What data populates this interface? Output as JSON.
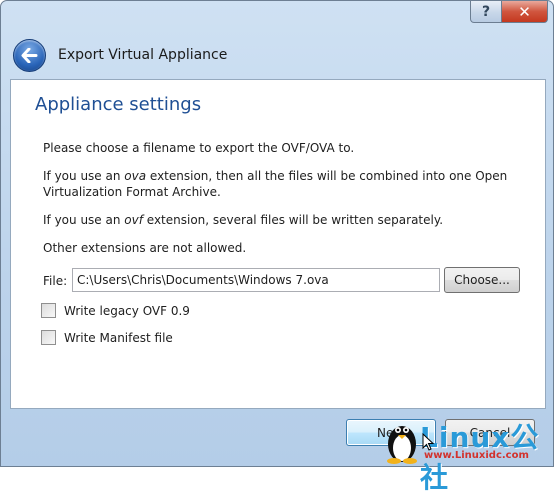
{
  "window": {
    "help_glyph": "?",
    "close_glyph": "✕",
    "wizard_title": "Export Virtual Appliance"
  },
  "page": {
    "heading": "Appliance settings",
    "para1": "Please choose a filename to export the OVF/OVA to.",
    "para2_a": "If you use an ",
    "para2_em": "ova",
    "para2_b": " extension, then all the files will be combined into one Open Virtualization Format Archive.",
    "para3_a": "If you use an ",
    "para3_em": "ovf",
    "para3_b": " extension, several files will be written separately.",
    "para4": "Other extensions are not allowed."
  },
  "file": {
    "label": "File:",
    "value": "C:\\Users\\Chris\\Documents\\Windows 7.ova",
    "choose_label": "Choose..."
  },
  "options": {
    "legacy_label": "Write legacy OVF 0.9",
    "legacy_checked": false,
    "manifest_label": "Write Manifest file",
    "manifest_checked": false
  },
  "footer": {
    "next_label": "Next",
    "cancel_label": "Cancel"
  },
  "watermark": {
    "logo_text": "Linux公社",
    "url": "www.Linuxidc.com"
  },
  "colors": {
    "heading": "#1f4f94",
    "frame": "#bcd3eb",
    "close_button": "#c4381f"
  }
}
